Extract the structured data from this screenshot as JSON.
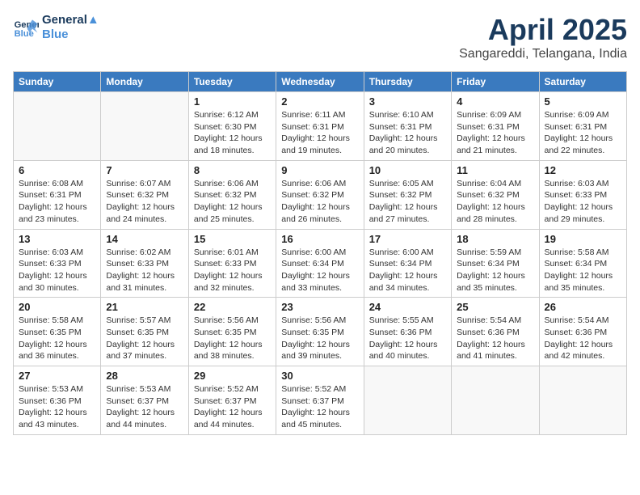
{
  "header": {
    "logo_line1": "General",
    "logo_line2": "Blue",
    "title": "April 2025",
    "subtitle": "Sangareddi, Telangana, India"
  },
  "days_of_week": [
    "Sunday",
    "Monday",
    "Tuesday",
    "Wednesday",
    "Thursday",
    "Friday",
    "Saturday"
  ],
  "weeks": [
    [
      {
        "day": "",
        "info": ""
      },
      {
        "day": "",
        "info": ""
      },
      {
        "day": "1",
        "info": "Sunrise: 6:12 AM\nSunset: 6:30 PM\nDaylight: 12 hours and 18 minutes."
      },
      {
        "day": "2",
        "info": "Sunrise: 6:11 AM\nSunset: 6:31 PM\nDaylight: 12 hours and 19 minutes."
      },
      {
        "day": "3",
        "info": "Sunrise: 6:10 AM\nSunset: 6:31 PM\nDaylight: 12 hours and 20 minutes."
      },
      {
        "day": "4",
        "info": "Sunrise: 6:09 AM\nSunset: 6:31 PM\nDaylight: 12 hours and 21 minutes."
      },
      {
        "day": "5",
        "info": "Sunrise: 6:09 AM\nSunset: 6:31 PM\nDaylight: 12 hours and 22 minutes."
      }
    ],
    [
      {
        "day": "6",
        "info": "Sunrise: 6:08 AM\nSunset: 6:31 PM\nDaylight: 12 hours and 23 minutes."
      },
      {
        "day": "7",
        "info": "Sunrise: 6:07 AM\nSunset: 6:32 PM\nDaylight: 12 hours and 24 minutes."
      },
      {
        "day": "8",
        "info": "Sunrise: 6:06 AM\nSunset: 6:32 PM\nDaylight: 12 hours and 25 minutes."
      },
      {
        "day": "9",
        "info": "Sunrise: 6:06 AM\nSunset: 6:32 PM\nDaylight: 12 hours and 26 minutes."
      },
      {
        "day": "10",
        "info": "Sunrise: 6:05 AM\nSunset: 6:32 PM\nDaylight: 12 hours and 27 minutes."
      },
      {
        "day": "11",
        "info": "Sunrise: 6:04 AM\nSunset: 6:32 PM\nDaylight: 12 hours and 28 minutes."
      },
      {
        "day": "12",
        "info": "Sunrise: 6:03 AM\nSunset: 6:33 PM\nDaylight: 12 hours and 29 minutes."
      }
    ],
    [
      {
        "day": "13",
        "info": "Sunrise: 6:03 AM\nSunset: 6:33 PM\nDaylight: 12 hours and 30 minutes."
      },
      {
        "day": "14",
        "info": "Sunrise: 6:02 AM\nSunset: 6:33 PM\nDaylight: 12 hours and 31 minutes."
      },
      {
        "day": "15",
        "info": "Sunrise: 6:01 AM\nSunset: 6:33 PM\nDaylight: 12 hours and 32 minutes."
      },
      {
        "day": "16",
        "info": "Sunrise: 6:00 AM\nSunset: 6:34 PM\nDaylight: 12 hours and 33 minutes."
      },
      {
        "day": "17",
        "info": "Sunrise: 6:00 AM\nSunset: 6:34 PM\nDaylight: 12 hours and 34 minutes."
      },
      {
        "day": "18",
        "info": "Sunrise: 5:59 AM\nSunset: 6:34 PM\nDaylight: 12 hours and 35 minutes."
      },
      {
        "day": "19",
        "info": "Sunrise: 5:58 AM\nSunset: 6:34 PM\nDaylight: 12 hours and 35 minutes."
      }
    ],
    [
      {
        "day": "20",
        "info": "Sunrise: 5:58 AM\nSunset: 6:35 PM\nDaylight: 12 hours and 36 minutes."
      },
      {
        "day": "21",
        "info": "Sunrise: 5:57 AM\nSunset: 6:35 PM\nDaylight: 12 hours and 37 minutes."
      },
      {
        "day": "22",
        "info": "Sunrise: 5:56 AM\nSunset: 6:35 PM\nDaylight: 12 hours and 38 minutes."
      },
      {
        "day": "23",
        "info": "Sunrise: 5:56 AM\nSunset: 6:35 PM\nDaylight: 12 hours and 39 minutes."
      },
      {
        "day": "24",
        "info": "Sunrise: 5:55 AM\nSunset: 6:36 PM\nDaylight: 12 hours and 40 minutes."
      },
      {
        "day": "25",
        "info": "Sunrise: 5:54 AM\nSunset: 6:36 PM\nDaylight: 12 hours and 41 minutes."
      },
      {
        "day": "26",
        "info": "Sunrise: 5:54 AM\nSunset: 6:36 PM\nDaylight: 12 hours and 42 minutes."
      }
    ],
    [
      {
        "day": "27",
        "info": "Sunrise: 5:53 AM\nSunset: 6:36 PM\nDaylight: 12 hours and 43 minutes."
      },
      {
        "day": "28",
        "info": "Sunrise: 5:53 AM\nSunset: 6:37 PM\nDaylight: 12 hours and 44 minutes."
      },
      {
        "day": "29",
        "info": "Sunrise: 5:52 AM\nSunset: 6:37 PM\nDaylight: 12 hours and 44 minutes."
      },
      {
        "day": "30",
        "info": "Sunrise: 5:52 AM\nSunset: 6:37 PM\nDaylight: 12 hours and 45 minutes."
      },
      {
        "day": "",
        "info": ""
      },
      {
        "day": "",
        "info": ""
      },
      {
        "day": "",
        "info": ""
      }
    ]
  ]
}
